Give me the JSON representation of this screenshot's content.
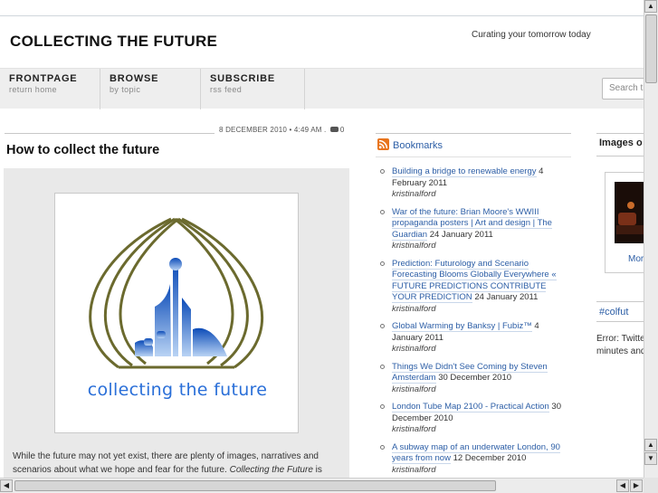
{
  "header": {
    "site_title": "COLLECTING THE FUTURE",
    "tagline": "Curating your tomorrow today"
  },
  "nav": {
    "items": [
      {
        "label": "FRONTPAGE",
        "sub": "return home"
      },
      {
        "label": "BROWSE",
        "sub": "by topic"
      },
      {
        "label": "SUBSCRIBE",
        "sub": "rss feed"
      }
    ],
    "search_placeholder": "Search th"
  },
  "post": {
    "meta": "8 DECEMBER 2010 • 4:49 AM .",
    "comment_count": "0",
    "title": "How to collect the future",
    "logo_text": "collecting the future",
    "excerpt_start": "While the future may not yet exist, there are plenty of images, narratives and scenarios about what we hope and fear for the future. ",
    "excerpt_em": "Collecting the Future",
    "excerpt_end": " is an"
  },
  "bookmarks": {
    "title": "Bookmarks",
    "items": [
      {
        "link": "Building a bridge to renewable energy",
        "date": " 4 February 2011",
        "user": "kristinalford"
      },
      {
        "link": "War of the future: Brian Moore's WWIII propaganda posters | Art and design | The Guardian",
        "date": " 24 January 2011",
        "user": "kristinalford"
      },
      {
        "link": "Prediction: Futurology and Scenario Forecasting Blooms Globally Everywhere « FUTURE PREDICTIONS CONTRIBUTE YOUR PREDICTION",
        "date": " 24 January 2011",
        "user": "kristinalford"
      },
      {
        "link": "Global Warming by Banksy | Fubiz™",
        "date": " 4 January 2011",
        "user": "kristinalford"
      },
      {
        "link": "Things We Didn't See Coming by Steven Amsterdam",
        "date": " 30 December 2010",
        "user": "kristinalford"
      },
      {
        "link": "London Tube Map 2100 - Practical Action",
        "date": " 30 December 2010",
        "user": "kristinalford"
      },
      {
        "link": "A subway map of an underwater London, 90 years from now",
        "date": " 12 December 2010",
        "user": "kristinalford"
      }
    ]
  },
  "sidebar": {
    "images_title": "Images o",
    "more_link": "Mor",
    "colfut_title": "#colfut",
    "error_line1": "Error: Twitte",
    "error_line2": "minutes and"
  },
  "scrollbars": {
    "up": "▲",
    "down": "▼",
    "left": "◀",
    "right": "▶"
  },
  "colors": {
    "link": "#2c5ea6",
    "logo_blue": "#2a6fd8",
    "logo_olive": "#6b6a2e",
    "rss_orange": "#e8741c",
    "nav_bg": "#eeeeee"
  }
}
